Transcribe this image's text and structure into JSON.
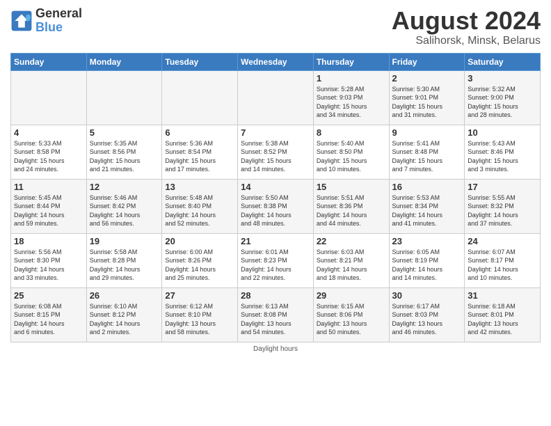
{
  "header": {
    "logo_line1": "General",
    "logo_line2": "Blue",
    "month_title": "August 2024",
    "subtitle": "Salihorsk, Minsk, Belarus"
  },
  "days_of_week": [
    "Sunday",
    "Monday",
    "Tuesday",
    "Wednesday",
    "Thursday",
    "Friday",
    "Saturday"
  ],
  "footer_text": "Daylight hours",
  "weeks": [
    [
      {
        "day": "",
        "info": ""
      },
      {
        "day": "",
        "info": ""
      },
      {
        "day": "",
        "info": ""
      },
      {
        "day": "",
        "info": ""
      },
      {
        "day": "1",
        "info": "Sunrise: 5:28 AM\nSunset: 9:03 PM\nDaylight: 15 hours\nand 34 minutes."
      },
      {
        "day": "2",
        "info": "Sunrise: 5:30 AM\nSunset: 9:01 PM\nDaylight: 15 hours\nand 31 minutes."
      },
      {
        "day": "3",
        "info": "Sunrise: 5:32 AM\nSunset: 9:00 PM\nDaylight: 15 hours\nand 28 minutes."
      }
    ],
    [
      {
        "day": "4",
        "info": "Sunrise: 5:33 AM\nSunset: 8:58 PM\nDaylight: 15 hours\nand 24 minutes."
      },
      {
        "day": "5",
        "info": "Sunrise: 5:35 AM\nSunset: 8:56 PM\nDaylight: 15 hours\nand 21 minutes."
      },
      {
        "day": "6",
        "info": "Sunrise: 5:36 AM\nSunset: 8:54 PM\nDaylight: 15 hours\nand 17 minutes."
      },
      {
        "day": "7",
        "info": "Sunrise: 5:38 AM\nSunset: 8:52 PM\nDaylight: 15 hours\nand 14 minutes."
      },
      {
        "day": "8",
        "info": "Sunrise: 5:40 AM\nSunset: 8:50 PM\nDaylight: 15 hours\nand 10 minutes."
      },
      {
        "day": "9",
        "info": "Sunrise: 5:41 AM\nSunset: 8:48 PM\nDaylight: 15 hours\nand 7 minutes."
      },
      {
        "day": "10",
        "info": "Sunrise: 5:43 AM\nSunset: 8:46 PM\nDaylight: 15 hours\nand 3 minutes."
      }
    ],
    [
      {
        "day": "11",
        "info": "Sunrise: 5:45 AM\nSunset: 8:44 PM\nDaylight: 14 hours\nand 59 minutes."
      },
      {
        "day": "12",
        "info": "Sunrise: 5:46 AM\nSunset: 8:42 PM\nDaylight: 14 hours\nand 56 minutes."
      },
      {
        "day": "13",
        "info": "Sunrise: 5:48 AM\nSunset: 8:40 PM\nDaylight: 14 hours\nand 52 minutes."
      },
      {
        "day": "14",
        "info": "Sunrise: 5:50 AM\nSunset: 8:38 PM\nDaylight: 14 hours\nand 48 minutes."
      },
      {
        "day": "15",
        "info": "Sunrise: 5:51 AM\nSunset: 8:36 PM\nDaylight: 14 hours\nand 44 minutes."
      },
      {
        "day": "16",
        "info": "Sunrise: 5:53 AM\nSunset: 8:34 PM\nDaylight: 14 hours\nand 41 minutes."
      },
      {
        "day": "17",
        "info": "Sunrise: 5:55 AM\nSunset: 8:32 PM\nDaylight: 14 hours\nand 37 minutes."
      }
    ],
    [
      {
        "day": "18",
        "info": "Sunrise: 5:56 AM\nSunset: 8:30 PM\nDaylight: 14 hours\nand 33 minutes."
      },
      {
        "day": "19",
        "info": "Sunrise: 5:58 AM\nSunset: 8:28 PM\nDaylight: 14 hours\nand 29 minutes."
      },
      {
        "day": "20",
        "info": "Sunrise: 6:00 AM\nSunset: 8:26 PM\nDaylight: 14 hours\nand 25 minutes."
      },
      {
        "day": "21",
        "info": "Sunrise: 6:01 AM\nSunset: 8:23 PM\nDaylight: 14 hours\nand 22 minutes."
      },
      {
        "day": "22",
        "info": "Sunrise: 6:03 AM\nSunset: 8:21 PM\nDaylight: 14 hours\nand 18 minutes."
      },
      {
        "day": "23",
        "info": "Sunrise: 6:05 AM\nSunset: 8:19 PM\nDaylight: 14 hours\nand 14 minutes."
      },
      {
        "day": "24",
        "info": "Sunrise: 6:07 AM\nSunset: 8:17 PM\nDaylight: 14 hours\nand 10 minutes."
      }
    ],
    [
      {
        "day": "25",
        "info": "Sunrise: 6:08 AM\nSunset: 8:15 PM\nDaylight: 14 hours\nand 6 minutes."
      },
      {
        "day": "26",
        "info": "Sunrise: 6:10 AM\nSunset: 8:12 PM\nDaylight: 14 hours\nand 2 minutes."
      },
      {
        "day": "27",
        "info": "Sunrise: 6:12 AM\nSunset: 8:10 PM\nDaylight: 13 hours\nand 58 minutes."
      },
      {
        "day": "28",
        "info": "Sunrise: 6:13 AM\nSunset: 8:08 PM\nDaylight: 13 hours\nand 54 minutes."
      },
      {
        "day": "29",
        "info": "Sunrise: 6:15 AM\nSunset: 8:06 PM\nDaylight: 13 hours\nand 50 minutes."
      },
      {
        "day": "30",
        "info": "Sunrise: 6:17 AM\nSunset: 8:03 PM\nDaylight: 13 hours\nand 46 minutes."
      },
      {
        "day": "31",
        "info": "Sunrise: 6:18 AM\nSunset: 8:01 PM\nDaylight: 13 hours\nand 42 minutes."
      }
    ]
  ]
}
